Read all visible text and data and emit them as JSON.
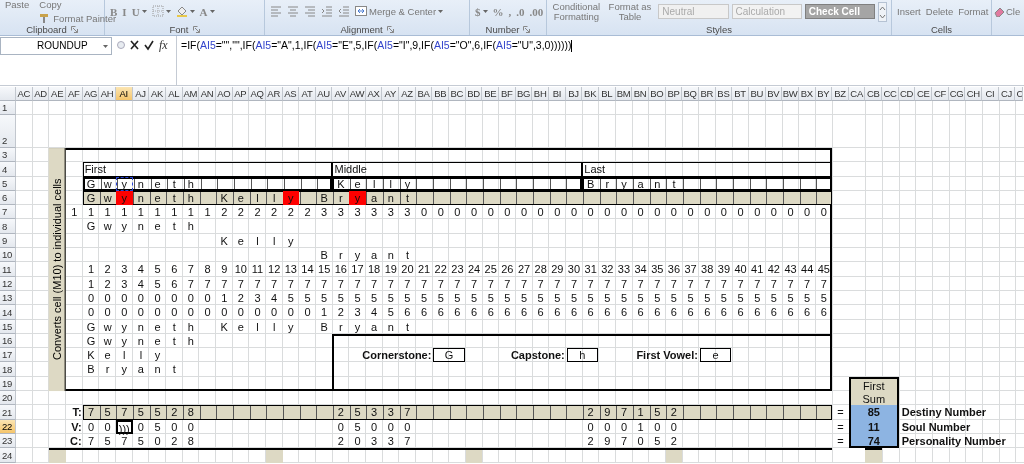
{
  "ribbon": {
    "groups": [
      {
        "kind": "clipboard",
        "label": "Clipboard",
        "items": [
          {
            "kind": "big",
            "label": "Paste"
          },
          {
            "kind": "text",
            "label": "Copy"
          },
          {
            "kind": "small",
            "label": "Format Painter"
          }
        ]
      },
      {
        "kind": "font",
        "label": "Font",
        "items": [
          {
            "kind": "glyph",
            "label": "B",
            "dropdown": false
          },
          {
            "kind": "glyph",
            "label": "I",
            "dropdown": false
          },
          {
            "kind": "glyph",
            "label": "U",
            "dropdown": true
          },
          {
            "kind": "icon",
            "dropdown": true
          },
          {
            "kind": "icon",
            "dropdown": true
          },
          {
            "kind": "glyph",
            "label": "A",
            "dropdown": true
          }
        ]
      },
      {
        "kind": "alignment",
        "label": "Alignment",
        "items": [
          {
            "kind": "icon",
            "dropdown": false
          },
          {
            "kind": "icon",
            "dropdown": false
          },
          {
            "kind": "icon",
            "dropdown": false
          },
          {
            "kind": "icon",
            "dropdown": false
          },
          {
            "kind": "icon",
            "dropdown": false
          },
          {
            "kind": "small",
            "label": "Merge & Center",
            "dropdown": true
          }
        ]
      },
      {
        "kind": "number",
        "label": "Number",
        "items": [
          {
            "kind": "glyph",
            "label": "$",
            "dropdown": true
          },
          {
            "kind": "glyph",
            "label": "%",
            "dropdown": false
          },
          {
            "kind": "glyph",
            "label": ",",
            "dropdown": false
          },
          {
            "kind": "glyph",
            "label": ".0",
            "dropdown": false
          },
          {
            "kind": "glyph",
            "label": ".00",
            "dropdown": false
          }
        ]
      },
      {
        "kind": "styles",
        "label": "Styles",
        "items": [
          {
            "kind": "two-line",
            "label": "Conditional Formatting"
          },
          {
            "kind": "two-line",
            "label": "Format as Table"
          },
          {
            "kind": "style",
            "label": "Neutral",
            "color": "#f0f0f0"
          },
          {
            "kind": "style",
            "label": "Calculation",
            "color": "#f2f2f2"
          },
          {
            "kind": "style",
            "label": "Check Cell",
            "color": "#a5a5a5"
          }
        ]
      },
      {
        "kind": "cells",
        "label": "Cells",
        "items": [
          {
            "kind": "text",
            "label": "Insert"
          },
          {
            "kind": "text",
            "label": "Delete"
          },
          {
            "kind": "text",
            "label": "Format"
          }
        ]
      },
      {
        "kind": "edit",
        "items": [
          {
            "kind": "small",
            "label": "Cle"
          }
        ]
      }
    ]
  },
  "formula_bar": {
    "name_box": "ROUNDUP",
    "function_label": "fx",
    "formula": [
      {
        "text": "=IF(",
        "color": "#000000"
      },
      {
        "text": "AI5",
        "color": "#3344cc"
      },
      {
        "text": "=\"\",\"\",IF(",
        "color": "#000000"
      },
      {
        "text": "AI5",
        "color": "#3344cc"
      },
      {
        "text": "=\"A\",1,IF(",
        "color": "#000000"
      },
      {
        "text": "AI5",
        "color": "#3344cc"
      },
      {
        "text": "=\"E\",5,IF(",
        "color": "#000000"
      },
      {
        "text": "AI5",
        "color": "#3344cc"
      },
      {
        "text": "=\"I\",9,IF(",
        "color": "#000000"
      },
      {
        "text": "AI5",
        "color": "#3344cc"
      },
      {
        "text": "=\"O\",6,IF(",
        "color": "#000000"
      },
      {
        "text": "AI5",
        "color": "#3344cc"
      },
      {
        "text": "=\"U\",3,0))))))",
        "color": "#000000"
      }
    ]
  },
  "sheet": {
    "columns": [
      {
        "label": "AC",
        "selected": false
      },
      {
        "label": "AD",
        "selected": false
      },
      {
        "label": "AE",
        "selected": false
      },
      {
        "label": "AF",
        "selected": false
      },
      {
        "label": "AG",
        "selected": false
      },
      {
        "label": "AH",
        "selected": false
      },
      {
        "label": "AI",
        "selected": true
      },
      {
        "label": "AJ",
        "selected": false
      },
      {
        "label": "AK",
        "selected": false
      },
      {
        "label": "AL",
        "selected": false
      },
      {
        "label": "AM",
        "selected": false
      },
      {
        "label": "AN",
        "selected": false
      },
      {
        "label": "AO",
        "selected": false
      },
      {
        "label": "AP",
        "selected": false
      },
      {
        "label": "AQ",
        "selected": false
      },
      {
        "label": "AR",
        "selected": false
      },
      {
        "label": "AS",
        "selected": false
      },
      {
        "label": "AT",
        "selected": false
      },
      {
        "label": "AU",
        "selected": false
      },
      {
        "label": "AV",
        "selected": false
      },
      {
        "label": "AW",
        "selected": false
      },
      {
        "label": "AX",
        "selected": false
      },
      {
        "label": "AY",
        "selected": false
      },
      {
        "label": "AZ",
        "selected": false
      },
      {
        "label": "BA",
        "selected": false
      },
      {
        "label": "BB",
        "selected": false
      },
      {
        "label": "BC",
        "selected": false
      },
      {
        "label": "BD",
        "selected": false
      },
      {
        "label": "BE",
        "selected": false
      },
      {
        "label": "BF",
        "selected": false
      },
      {
        "label": "BG",
        "selected": false
      },
      {
        "label": "BH",
        "selected": false
      },
      {
        "label": "BI",
        "selected": false
      },
      {
        "label": "BJ",
        "selected": false
      },
      {
        "label": "BK",
        "selected": false
      },
      {
        "label": "BL",
        "selected": false
      },
      {
        "label": "BM",
        "selected": false
      },
      {
        "label": "BN",
        "selected": false
      },
      {
        "label": "BO",
        "selected": false
      },
      {
        "label": "BP",
        "selected": false
      },
      {
        "label": "BQ",
        "selected": false
      },
      {
        "label": "BR",
        "selected": false
      },
      {
        "label": "BS",
        "selected": false
      },
      {
        "label": "BT",
        "selected": false
      },
      {
        "label": "BU",
        "selected": false
      },
      {
        "label": "BV",
        "selected": false
      },
      {
        "label": "BW",
        "selected": false
      },
      {
        "label": "BX",
        "selected": false
      },
      {
        "label": "BY",
        "selected": false
      },
      {
        "label": "BZ",
        "selected": false
      },
      {
        "label": "CA",
        "selected": false
      },
      {
        "label": "CB",
        "selected": false
      },
      {
        "label": "CC",
        "selected": false
      },
      {
        "label": "CD",
        "selected": false
      },
      {
        "label": "CE",
        "selected": false
      },
      {
        "label": "CF",
        "selected": false
      },
      {
        "label": "CG",
        "selected": false
      },
      {
        "label": "CH",
        "selected": false
      },
      {
        "label": "CI",
        "selected": false
      },
      {
        "label": "CJ",
        "selected": false
      },
      {
        "label": "C",
        "selected": false
      }
    ],
    "rows": [
      {
        "header": "1",
        "selected": false
      },
      {
        "header": "2",
        "selected": false
      },
      {
        "header": "3",
        "selected": false
      },
      {
        "header": "4",
        "selected": false
      },
      {
        "header": "5",
        "selected": false
      },
      {
        "header": "6",
        "selected": false
      },
      {
        "header": "7",
        "selected": false
      },
      {
        "header": "8",
        "selected": false
      },
      {
        "header": "9",
        "selected": false
      },
      {
        "header": "10",
        "selected": false
      },
      {
        "header": "11",
        "selected": false
      },
      {
        "header": "12",
        "selected": false
      },
      {
        "header": "13",
        "selected": false
      },
      {
        "header": "14",
        "selected": false
      },
      {
        "header": "15",
        "selected": false
      },
      {
        "header": "16",
        "selected": false
      },
      {
        "header": "17",
        "selected": false
      },
      {
        "header": "18",
        "selected": false
      },
      {
        "header": "19",
        "selected": false
      },
      {
        "header": "20",
        "selected": false
      },
      {
        "header": "21",
        "selected": false
      },
      {
        "header": "22",
        "selected": true
      },
      {
        "header": "23",
        "selected": false
      },
      {
        "header": "24",
        "selected": false
      }
    ],
    "side_label": "Converts cell (M10) to individual cells",
    "headings": [
      "First",
      "Middle",
      "Last"
    ],
    "entered": [
      [
        "G",
        "w",
        {
          "text": "y",
          "referenced": true
        },
        "n",
        "e",
        "t",
        "h"
      ],
      [
        "K",
        "e",
        "l",
        "l",
        "y"
      ],
      [
        "B",
        "r",
        "y",
        "a",
        "n",
        "t"
      ]
    ],
    "combined": [
      [
        "G",
        "w",
        {
          "text": "y",
          "color": "#ff0000"
        },
        "n",
        "e",
        "t",
        "h"
      ],
      [
        "K",
        "e",
        "l",
        "l",
        {
          "text": "y",
          "color": "#ff0000"
        }
      ],
      [
        "B",
        "r",
        {
          "text": "y",
          "color": "#ff0000"
        },
        "a",
        "n",
        "t"
      ]
    ],
    "positions": [
      "1",
      "1",
      "1",
      "1",
      "1",
      "1",
      "1",
      "1",
      "1",
      "2",
      "2",
      "2",
      "2",
      "2",
      "2",
      "3",
      "3",
      "3",
      "3",
      "3",
      "3",
      "0",
      "0",
      "0",
      "0",
      "0",
      "0",
      "0",
      "0",
      "0",
      "0",
      "0",
      "0",
      "0",
      "0",
      "0",
      "0",
      "0",
      "0",
      "0",
      "0",
      "0",
      "0",
      "0",
      "0",
      "0"
    ],
    "staggered": [
      [
        "G",
        "w",
        "y",
        "n",
        "e",
        "t",
        "h"
      ],
      [
        "K",
        "e",
        "l",
        "l",
        "y"
      ],
      [
        "B",
        "r",
        "y",
        "a",
        "n",
        "t"
      ]
    ],
    "sequences": [
      [
        "1",
        "2",
        "3",
        "4",
        "5",
        "6",
        "7",
        "8",
        "9",
        "10",
        "11",
        "12",
        "13",
        "14",
        "15",
        "16",
        "17",
        "18",
        "19",
        "20",
        "21",
        "22",
        "23",
        "24",
        "25",
        "26",
        "27",
        "28",
        "29",
        "30",
        "31",
        "32",
        "33",
        "34",
        "35",
        "36",
        "37",
        "38",
        "39",
        "40",
        "41",
        "42",
        "43",
        "44",
        "45"
      ],
      [
        "1",
        "2",
        "3",
        "4",
        "5",
        "6",
        "7",
        "7",
        "7",
        "7",
        "7",
        "7",
        "7",
        "7",
        "7",
        "7",
        "7",
        "7",
        "7",
        "7",
        "7",
        "7",
        "7",
        "7",
        "7",
        "7",
        "7",
        "7",
        "7",
        "7",
        "7",
        "7",
        "7",
        "7",
        "7",
        "7",
        "7",
        "7",
        "7",
        "7",
        "7",
        "7",
        "7",
        "7",
        "7"
      ],
      [
        "0",
        "0",
        "0",
        "0",
        "0",
        "0",
        "0",
        "0",
        "1",
        "2",
        "3",
        "4",
        "5",
        "5",
        "5",
        "5",
        "5",
        "5",
        "5",
        "5",
        "5",
        "5",
        "5",
        "5",
        "5",
        "5",
        "5",
        "5",
        "5",
        "5",
        "5",
        "5",
        "5",
        "5",
        "5",
        "5",
        "5",
        "5",
        "5",
        "5",
        "5",
        "5",
        "5",
        "5",
        "5"
      ],
      [
        "0",
        "0",
        "0",
        "0",
        "0",
        "0",
        "0",
        "0",
        "0",
        "0",
        "0",
        "0",
        "0",
        "0",
        "1",
        "2",
        "3",
        "4",
        "5",
        "6",
        "6",
        "6",
        "6",
        "6",
        "6",
        "6",
        "6",
        "6",
        "6",
        "6",
        "6",
        "6",
        "6",
        "6",
        "6",
        "6",
        "6",
        "6",
        "6",
        "6",
        "6",
        "6",
        "6",
        "6",
        "6"
      ]
    ],
    "repeated": [
      [
        "G",
        "w",
        "y",
        "n",
        "e",
        "t",
        "h"
      ],
      [
        "K",
        "e",
        "l",
        "l",
        "y"
      ],
      [
        "B",
        "r",
        "y",
        "a",
        "n",
        "t"
      ]
    ],
    "stacked": [
      [
        "G",
        "w",
        "y",
        "n",
        "e",
        "t",
        "h"
      ],
      [
        "K",
        "e",
        "l",
        "l",
        "y"
      ],
      [
        "B",
        "r",
        "y",
        "a",
        "n",
        "t"
      ]
    ],
    "keys": [
      {
        "label": "Cornerstone:",
        "value": "G"
      },
      {
        "label": "Capstone:",
        "value": "h"
      },
      {
        "label": "First Vowel:",
        "value": "e"
      }
    ],
    "sum_header": "First Sum",
    "totals": [
      {
        "label": "T:",
        "groups": [
          [
            "7",
            "5",
            "7",
            "5",
            "5",
            "2",
            "8"
          ],
          [
            "2",
            "5",
            "3",
            "3",
            "7"
          ],
          [
            "2",
            "9",
            "7",
            "1",
            "5",
            "2"
          ]
        ],
        "equals": "=",
        "sum": "85",
        "name": "Destiny Number"
      },
      {
        "label": "V:",
        "groups": [
          [
            "0",
            "0",
            {
              "text": ")))",
              "editing": true
            },
            "0",
            "5",
            "0",
            "0"
          ],
          [
            "0",
            "5",
            "0",
            "0",
            "0"
          ],
          [
            "0",
            "0",
            "0",
            "1",
            "0",
            "0"
          ]
        ],
        "equals": "=",
        "sum": "11",
        "name": "Soul Number"
      },
      {
        "label": "C:",
        "groups": [
          [
            "7",
            "5",
            "7",
            "5",
            "0",
            "2",
            "8"
          ],
          [
            "2",
            "0",
            "3",
            "3",
            "7"
          ],
          [
            "2",
            "9",
            "7",
            "0",
            "5",
            "2"
          ]
        ],
        "equals": "=",
        "sum": "74",
        "name": "Personality Number"
      }
    ]
  }
}
